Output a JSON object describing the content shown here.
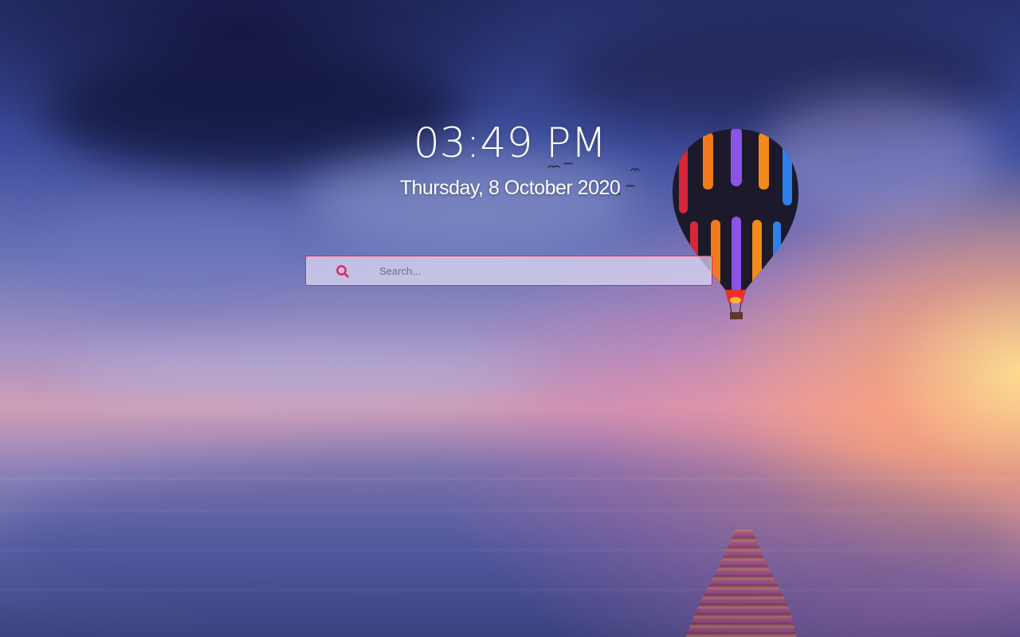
{
  "clock": {
    "time": "03:49 PM"
  },
  "date": {
    "text": "Thursday, 8 October 2020"
  },
  "search": {
    "placeholder": "Search...",
    "value": "",
    "icon": "search-icon",
    "accent_color": "#e0245e"
  },
  "wallpaper": {
    "scene": "hot-air-balloon-sunset-sea"
  }
}
